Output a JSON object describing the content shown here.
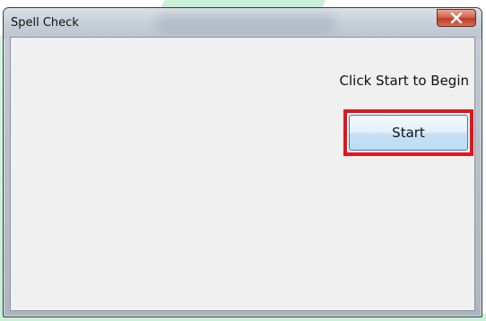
{
  "window": {
    "title": "Spell Check",
    "close_icon": "close-icon"
  },
  "content": {
    "prompt_text": "Click Start to Begin",
    "start_label": "Start",
    "highlight_color": "#e3151b"
  }
}
